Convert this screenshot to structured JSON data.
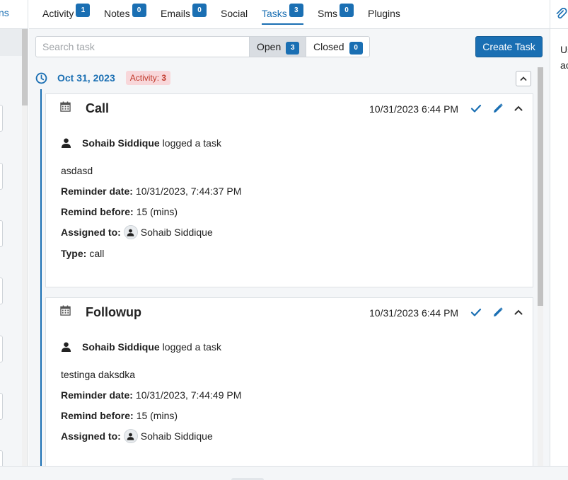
{
  "left_panel": {
    "tab_label_fragment": "ns"
  },
  "tabs": [
    {
      "label": "Activity",
      "count": "1"
    },
    {
      "label": "Notes",
      "count": "0"
    },
    {
      "label": "Emails",
      "count": "0"
    },
    {
      "label": "Social"
    },
    {
      "label": "Tasks",
      "count": "3",
      "active": true
    },
    {
      "label": "Sms",
      "count": "0"
    },
    {
      "label": "Plugins"
    }
  ],
  "toolbar": {
    "search_placeholder": "Search task",
    "open_label": "Open",
    "open_count": "3",
    "closed_label": "Closed",
    "closed_count": "0",
    "create_label": "Create Task"
  },
  "timeline": {
    "date": "Oct 31, 2023",
    "activity_label": "Activity:",
    "activity_count": "3"
  },
  "tasks": [
    {
      "title": "Call",
      "time": "10/31/2023 6:44 PM",
      "user": "Sohaib Siddique",
      "action": "logged a task",
      "description": "asdasd",
      "reminder_label": "Reminder date:",
      "reminder_value": "10/31/2023, 7:44:37 PM",
      "remind_before_label": "Remind before:",
      "remind_before_value": "15 (mins)",
      "assigned_label": "Assigned to:",
      "assigned_value": "Sohaib Siddique",
      "type_label": "Type:",
      "type_value": "call"
    },
    {
      "title": "Followup",
      "time": "10/31/2023 6:44 PM",
      "user": "Sohaib Siddique",
      "action": "logged a task",
      "description": "testinga daksdka",
      "reminder_label": "Reminder date:",
      "reminder_value": "10/31/2023, 7:44:49 PM",
      "remind_before_label": "Remind before:",
      "remind_before_value": "15 (mins)",
      "assigned_label": "Assigned to:",
      "assigned_value": "Sohaib Siddique"
    }
  ],
  "right_panel": {
    "text_line1": "Us",
    "text_line2": "ac"
  },
  "colors": {
    "accent": "#1a6fb3",
    "badge_bg": "#f8d7da",
    "badge_text": "#c0392b"
  },
  "icons": [
    "clock-icon",
    "calendar-icon",
    "check-icon",
    "pencil-icon",
    "chevron-up-icon",
    "person-icon",
    "paperclip-icon"
  ]
}
